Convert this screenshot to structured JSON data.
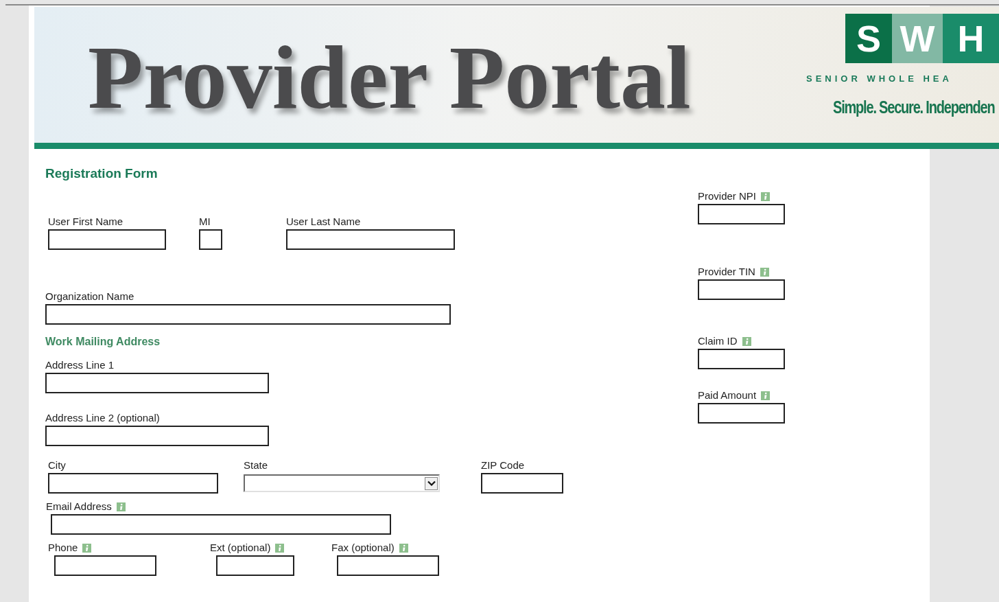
{
  "header": {
    "title": "Provider Portal",
    "logo_letters": [
      "S",
      "W",
      "H"
    ],
    "logo_subtitle": "SENIOR WHOLE HEA",
    "tagline": "Simple. Secure. Independen"
  },
  "form": {
    "title": "Registration Form",
    "left_rows": [
      {
        "kind": "fields",
        "fields": [
          {
            "label": "User First Name",
            "kind": "text",
            "info": false
          },
          {
            "label": "MI",
            "kind": "text",
            "info": false
          },
          {
            "label": "User Last Name",
            "kind": "text",
            "info": false
          }
        ]
      },
      {
        "kind": "fields",
        "fields": [
          {
            "label": "Organization Name",
            "kind": "text",
            "info": false
          }
        ]
      },
      {
        "kind": "heading",
        "text": "Work Mailing Address"
      },
      {
        "kind": "fields",
        "fields": [
          {
            "label": "Address Line 1",
            "kind": "text",
            "info": false
          }
        ]
      },
      {
        "kind": "fields",
        "fields": [
          {
            "label": "Address Line 2 (optional)",
            "kind": "text",
            "info": false
          }
        ]
      },
      {
        "kind": "fields",
        "fields": [
          {
            "label": "City",
            "kind": "text",
            "info": false
          },
          {
            "label": "State",
            "kind": "select",
            "info": false
          },
          {
            "label": "ZIP Code",
            "kind": "text",
            "info": false
          }
        ]
      },
      {
        "kind": "fields",
        "fields": [
          {
            "label": "Email Address",
            "kind": "text",
            "info": true
          }
        ]
      },
      {
        "kind": "fields",
        "fields": [
          {
            "label": "Phone",
            "kind": "text",
            "info": true
          },
          {
            "label": "Ext (optional)",
            "kind": "text",
            "info": true
          },
          {
            "label": "Fax (optional)",
            "kind": "text",
            "info": true
          }
        ]
      }
    ],
    "right_fields": [
      {
        "label": "Provider NPI",
        "kind": "text",
        "info": true
      },
      {
        "label": "Provider TIN",
        "kind": "text",
        "info": true
      },
      {
        "label": "Claim ID",
        "kind": "text",
        "info": true
      },
      {
        "label": "Paid Amount",
        "kind": "text",
        "info": true
      }
    ]
  }
}
